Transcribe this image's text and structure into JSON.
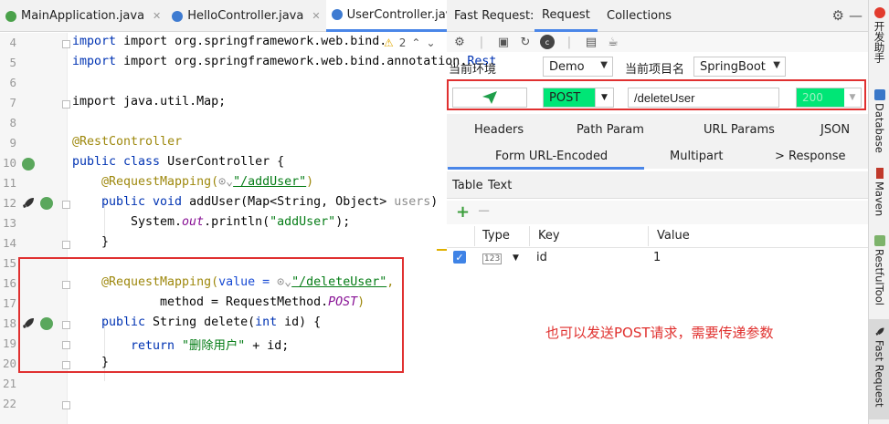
{
  "editor_tabs": [
    {
      "label": "MainApplication.java",
      "active": false,
      "icon": "java-class-icon"
    },
    {
      "label": "HelloController.java",
      "active": false,
      "icon": "java-class-icon"
    },
    {
      "label": "UserController.java",
      "active": true,
      "icon": "java-class-icon"
    }
  ],
  "warning": {
    "count": "2"
  },
  "code": {
    "line_numbers": [
      "4",
      "5",
      "6",
      "7",
      "8",
      "9",
      "10",
      "11",
      "12",
      "13",
      "14",
      "15",
      "16",
      "17",
      "18",
      "19",
      "20",
      "21",
      "22"
    ],
    "l4_pre": "import org.springframework.web.bind.annota",
    "l5_pre": "import org.springframework.web.bind.annotation.",
    "l5_clip": "Rest",
    "l7": "import java.util.Map;",
    "l9": "@RestController",
    "l10_kw": "public class ",
    "l10_rest": "UserController {",
    "l11_ann": "@RequestMapping(",
    "l11_url": "\"/addUser\"",
    "l11_end": ")",
    "l12_kw": "public void ",
    "l12_rest": "addUser(Map<String, Object> ",
    "l12_gray": "users",
    "l12_end": ")",
    "l13_pre": "System.",
    "l13_it": "out",
    "l13_mid": ".println(",
    "l13_str": "\"addUser\"",
    "l13_end": ");",
    "l14": "}",
    "l16_ann": "@RequestMapping(",
    "l16_mid": "value = ",
    "l16_url": "\"/deleteUser\"",
    "l16_end": ",",
    "l17_pre": "method = RequestMethod.",
    "l17_it": "POST",
    "l17_end": ")",
    "l18_kw": "public ",
    "l18_mid": "String delete(",
    "l18_int": "int ",
    "l18_end": "id) {",
    "l19_kw": "return ",
    "l19_str": "\"删除用户\"",
    "l19_end": " + id;",
    "l20": "}"
  },
  "fast_request": {
    "title": "Fast Request:",
    "tabs": [
      "Request",
      "Collections"
    ],
    "env_label": "当前环境",
    "env_value": "Demo",
    "project_label": "当前项目名",
    "project_value": "SpringBoot",
    "method": "POST",
    "url": "/deleteUser",
    "status": "200",
    "param_tabs_row1": [
      "Headers",
      "Path Param",
      "URL Params",
      "JSON"
    ],
    "param_tabs_row2": [
      "Form URL-Encoded",
      "Multipart",
      "> Response"
    ],
    "active_param_tab": "Form URL-Encoded",
    "sub_tabs": [
      "Table",
      "Text"
    ],
    "table_headers": [
      "Type",
      "Key",
      "Value"
    ],
    "rows": [
      {
        "checked": true,
        "type": "123",
        "key": "id",
        "value": "1"
      }
    ],
    "note": "也可以发送POST请求，需要传递参数"
  },
  "right_sidebar": [
    "开发助手",
    "Database",
    "Maven",
    "RestfulTool",
    "Fast Request"
  ],
  "colors": {
    "accent": "#4a86e8",
    "method_bg": "#00e676",
    "highlight": "#e03030",
    "note": "#e0302e"
  }
}
